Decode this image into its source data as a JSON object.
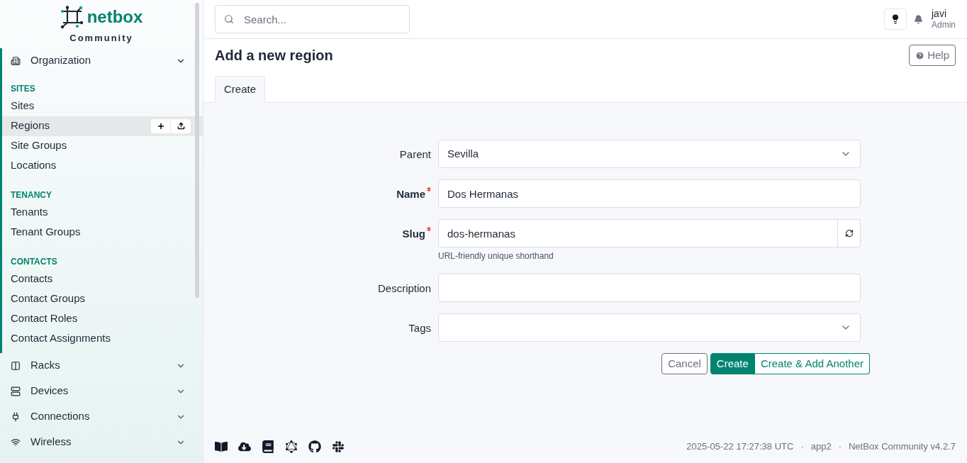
{
  "brand": {
    "name": "netbox",
    "edition": "Community"
  },
  "sidebar": {
    "menus": [
      {
        "label": "Organization",
        "expanded": true,
        "groups": [
          {
            "heading": "SITES",
            "items": [
              {
                "label": "Sites",
                "selected": false
              },
              {
                "label": "Regions",
                "selected": true
              },
              {
                "label": "Site Groups",
                "selected": false
              },
              {
                "label": "Locations",
                "selected": false
              }
            ]
          },
          {
            "heading": "TENANCY",
            "items": [
              {
                "label": "Tenants",
                "selected": false
              },
              {
                "label": "Tenant Groups",
                "selected": false
              }
            ]
          },
          {
            "heading": "CONTACTS",
            "items": [
              {
                "label": "Contacts",
                "selected": false
              },
              {
                "label": "Contact Groups",
                "selected": false
              },
              {
                "label": "Contact Roles",
                "selected": false
              },
              {
                "label": "Contact Assignments",
                "selected": false
              }
            ]
          }
        ]
      },
      {
        "label": "Racks",
        "expanded": false
      },
      {
        "label": "Devices",
        "expanded": false
      },
      {
        "label": "Connections",
        "expanded": false
      },
      {
        "label": "Wireless",
        "expanded": false
      }
    ]
  },
  "search": {
    "placeholder": "Search..."
  },
  "user": {
    "name": "javi",
    "role": "Admin"
  },
  "page": {
    "title": "Add a new region",
    "help": "Help",
    "tabs": [
      {
        "label": "Create",
        "selected": true
      }
    ]
  },
  "form": {
    "fields": [
      {
        "label": "Parent",
        "kind": "select",
        "required": false,
        "value": "Sevilla"
      },
      {
        "label": "Name",
        "kind": "text",
        "required": true,
        "value": "Dos Hermanas"
      },
      {
        "label": "Slug",
        "kind": "slug",
        "required": true,
        "value": "dos-hermanas",
        "help": "URL-friendly unique shorthand"
      },
      {
        "label": "Description",
        "kind": "text",
        "required": false
      },
      {
        "label": "Tags",
        "kind": "select",
        "required": false
      }
    ],
    "buttons": [
      {
        "label": "Cancel",
        "kind": "cancel"
      },
      {
        "label": "Create",
        "kind": "primary"
      },
      {
        "label": "Create & Add Another",
        "kind": "secondary"
      }
    ]
  },
  "footer": {
    "items": [
      "2025-05-22 17:27:38 UTC",
      "app2",
      "NetBox Community v4.2.7"
    ],
    "separator": "·"
  }
}
